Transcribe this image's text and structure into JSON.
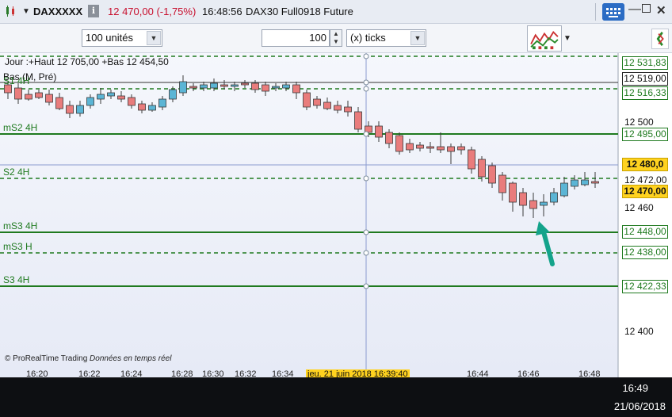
{
  "titlebar": {
    "symbol": "DAXXXXX",
    "info_glyph": "i",
    "price_change": "12 470,00 (-1,75%)",
    "time": "16:48:56",
    "instrument": "DAX30 Full0918 Future",
    "icons": [
      "chart-app-icon",
      "dropdown-icon",
      "info-icon",
      "keyboard-icon",
      "minimize-icon",
      "maximize-icon",
      "close-icon"
    ]
  },
  "toolbar": {
    "quantity_mode": "100 unités",
    "quantity_value": "100",
    "unit_mode": "(x) ticks"
  },
  "chart": {
    "header_line1": "Jour :+Haut 12 705,00 +Bas 12 454,50",
    "header_line2": "Bas (M, Pré)",
    "levels": [
      {
        "name": "S1 4H",
        "value": "12 516,33"
      },
      {
        "name": "mS2 4H",
        "value": "12 495,00"
      },
      {
        "name": "S2 4H",
        "value": "12 472,00"
      },
      {
        "name": "mS3 4H",
        "value": "12 448,00"
      },
      {
        "name": "mS3 H",
        "value": "12 438,00"
      },
      {
        "name": "S3 4H",
        "value": "12 422,33"
      }
    ],
    "top_level_value": "12 531,83",
    "black_level_value": "12 519,00",
    "cursor_value": "12 480,0",
    "last_price": "12 470,00",
    "axis_ticks": [
      "12 500",
      "12 460",
      "12 400"
    ],
    "time_labels": [
      "16:20",
      "16:22",
      "16:24",
      "16:28",
      "16:30",
      "16:32",
      "16:34",
      "16:44",
      "16:46",
      "16:48"
    ],
    "crosshair_time": "jeu. 21 juin 2018 16:39:40",
    "footer_brand": "© ProRealTime Trading",
    "footer_note": "Données en temps réel",
    "colors": {
      "bull": "#5bb5d5",
      "bear": "#e97c7c",
      "level": "#1f7a1f",
      "arrow": "#14a38b"
    }
  },
  "taskbar": {
    "time": "16:49",
    "date": "21/06/2018"
  }
}
